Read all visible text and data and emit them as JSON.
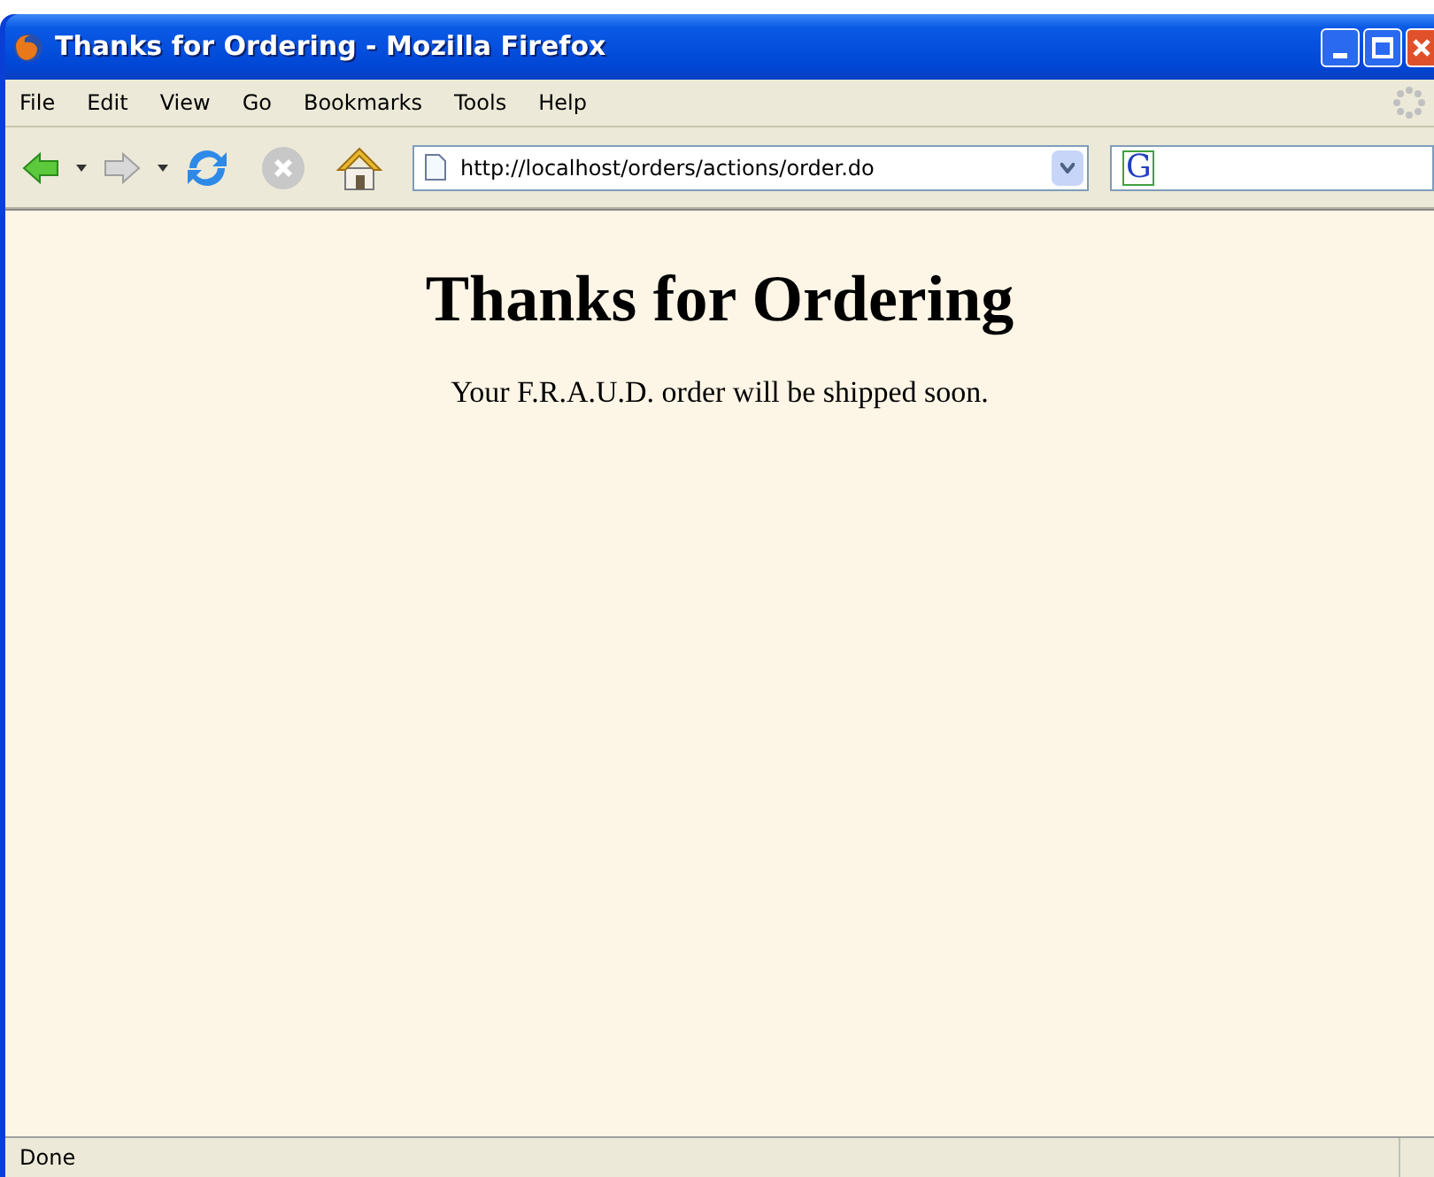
{
  "window": {
    "title": "Thanks for Ordering - Mozilla Firefox"
  },
  "menu": [
    "File",
    "Edit",
    "View",
    "Go",
    "Bookmarks",
    "Tools",
    "Help"
  ],
  "toolbar": {
    "url": "http://localhost/orders/actions/order.do",
    "search_glyph": "G"
  },
  "page": {
    "heading": "Thanks for Ordering",
    "message": "Your F.R.A.U.D. order will be shipped soon."
  },
  "status_bar": {
    "text": "Done"
  }
}
